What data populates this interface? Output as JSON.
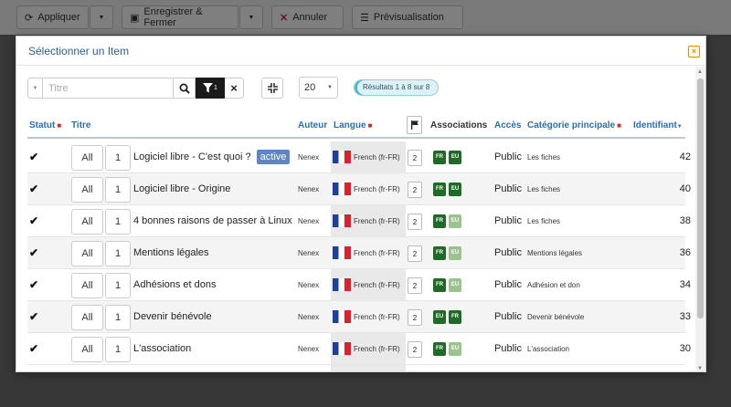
{
  "toolbar": {
    "apply": "Appliquer",
    "save_close": "Enregistrer & Fermer",
    "cancel": "Annuler",
    "preview": "Prévisualisation"
  },
  "modal": {
    "title": "Sélectionner un Item",
    "close": "×"
  },
  "filters": {
    "search_placeholder": "Titre",
    "filter_count": "1",
    "clear": "×",
    "limit": "20",
    "results": "Résultats 1 à 8 sur 8"
  },
  "table": {
    "headers": {
      "status": "Statut",
      "title": "Titre",
      "author": "Auteur",
      "language": "Langue",
      "associations": "Associations",
      "access": "Accès",
      "category": "Catégorie principale",
      "id": "Identifiant"
    },
    "all_label": "All",
    "rows": [
      {
        "title": "Logiciel libre - C'est quoi ?",
        "badge": "active",
        "author": "Nenex",
        "lang": "French (fr-FR)",
        "count": "2",
        "assoc": [
          {
            "label": "FR",
            "tone": "dark"
          },
          {
            "label": "EU",
            "tone": "dark"
          }
        ],
        "access": "Public",
        "category": "Les fiches",
        "id": "42",
        "num": "1"
      },
      {
        "title": "Logiciel libre - Origine",
        "badge": "",
        "author": "Nenex",
        "lang": "French (fr-FR)",
        "count": "2",
        "assoc": [
          {
            "label": "FR",
            "tone": "dark"
          },
          {
            "label": "EU",
            "tone": "dark"
          }
        ],
        "access": "Public",
        "category": "Les fiches",
        "id": "40",
        "num": "1"
      },
      {
        "title": "4 bonnes raisons de passer à Linux",
        "badge": "",
        "author": "Nenex",
        "lang": "French (fr-FR)",
        "count": "2",
        "assoc": [
          {
            "label": "FR",
            "tone": "dark"
          },
          {
            "label": "EU",
            "tone": "light"
          }
        ],
        "access": "Public",
        "category": "Les fiches",
        "id": "38",
        "num": "1"
      },
      {
        "title": "Mentions légales",
        "badge": "",
        "author": "Nenex",
        "lang": "French (fr-FR)",
        "count": "2",
        "assoc": [
          {
            "label": "FR",
            "tone": "dark"
          },
          {
            "label": "EU",
            "tone": "light"
          }
        ],
        "access": "Public",
        "category": "Mentions légales",
        "id": "36",
        "num": "1"
      },
      {
        "title": "Adhésions et dons",
        "badge": "",
        "author": "Nenex",
        "lang": "French (fr-FR)",
        "count": "2",
        "assoc": [
          {
            "label": "FR",
            "tone": "dark"
          },
          {
            "label": "EU",
            "tone": "light"
          }
        ],
        "access": "Public",
        "category": "Adhésion et don",
        "id": "34",
        "num": "1"
      },
      {
        "title": "Devenir bénévole",
        "badge": "",
        "author": "Nenex",
        "lang": "French (fr-FR)",
        "count": "2",
        "assoc": [
          {
            "label": "EU",
            "tone": "dark"
          },
          {
            "label": "FR",
            "tone": "dark"
          }
        ],
        "access": "Public",
        "category": "Devenir bénévole",
        "id": "33",
        "num": "1"
      },
      {
        "title": "L'association",
        "badge": "",
        "author": "Nenex",
        "lang": "French (fr-FR)",
        "count": "2",
        "assoc": [
          {
            "label": "FR",
            "tone": "dark"
          },
          {
            "label": "EU",
            "tone": "light"
          }
        ],
        "access": "Public",
        "category": "L'association",
        "id": "30",
        "num": "1"
      }
    ]
  }
}
